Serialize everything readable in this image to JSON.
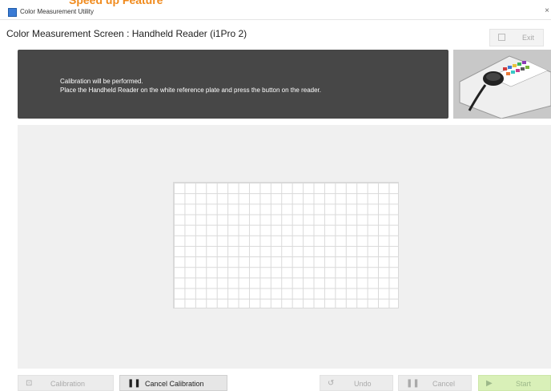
{
  "top_banner": {
    "partial_text": "Speed up Feature"
  },
  "window": {
    "title": "Color Measurement Utility",
    "close_glyph": "×",
    "app_icon": "app-icon"
  },
  "header": {
    "screen_title": "Color Measurement Screen : Handheld Reader (i1Pro 2)",
    "exit_label": "Exit"
  },
  "message": {
    "line1": "Calibration will be performed.",
    "line2": "Place the Handheld Reader on the white reference plate and press the button on the reader."
  },
  "grid": {
    "columns": 21,
    "rows": 12
  },
  "toolbar": {
    "calibration_label": "Calibration",
    "cancel_calibration_label": "Cancel Calibration",
    "undo_label": "Undo",
    "cancel_label": "Cancel",
    "start_label": "Start"
  },
  "colors": {
    "message_panel": "#474747",
    "start_button": "#d9f0b8",
    "banner_text": "#f08a1c",
    "content_area": "#f0f0f0"
  }
}
